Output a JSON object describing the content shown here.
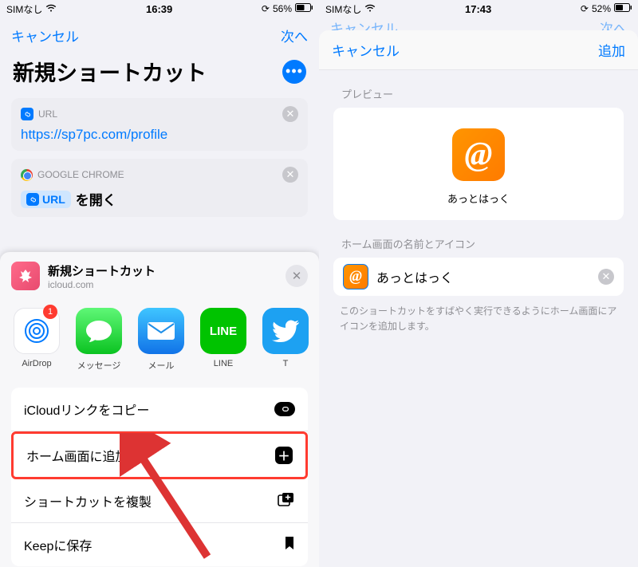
{
  "left": {
    "status": {
      "sim": "SIMなし",
      "time": "16:39",
      "battery": "56%"
    },
    "nav": {
      "cancel": "キャンセル",
      "next": "次へ"
    },
    "title": "新規ショートカット",
    "url_card": {
      "label": "URL",
      "url": "https://sp7pc.com/profile"
    },
    "chrome_card": {
      "label": "GOOGLE CHROME",
      "pill": "URL",
      "action": "を開く"
    },
    "share": {
      "title": "新規ショートカット",
      "subtitle": "icloud.com",
      "apps": [
        {
          "label": "AirDrop",
          "badge": "1"
        },
        {
          "label": "メッセージ"
        },
        {
          "label": "メール"
        },
        {
          "label": "LINE"
        },
        {
          "label": "T"
        }
      ],
      "actions": {
        "copy": "iCloudリンクをコピー",
        "home": "ホーム画面に追加",
        "dup": "ショートカットを複製",
        "keep": "Keepに保存"
      }
    }
  },
  "right": {
    "status": {
      "sim": "SIMなし",
      "time": "17:43",
      "battery": "52%"
    },
    "bg_nav": {
      "cancel": "キャンセル",
      "next": "次へ"
    },
    "modal_nav": {
      "cancel": "キャンセル",
      "add": "追加"
    },
    "preview_label": "プレビュー",
    "preview_name": "あっとはっく",
    "name_label": "ホーム画面の名前とアイコン",
    "name_value": "あっとはっく",
    "helper": "このショートカットをすばやく実行できるようにホーム画面にアイコンを追加します。"
  }
}
